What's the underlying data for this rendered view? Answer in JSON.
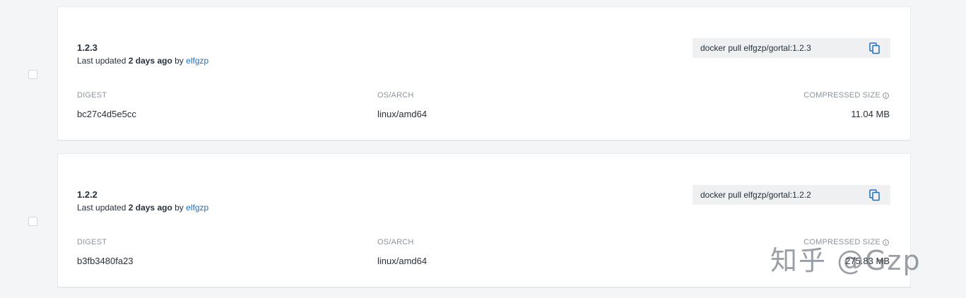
{
  "tags": [
    {
      "name": "1.2.3",
      "updated_prefix": "Last updated",
      "updated_when": "2 days ago",
      "updated_by_word": "by",
      "updated_by_user": "elfgzp",
      "pull_command": "docker pull elfgzp/gortal:1.2.3",
      "digest_label": "DIGEST",
      "digest": "bc27c4d5e5cc",
      "os_arch_label": "OS/ARCH",
      "os_arch": "linux/amd64",
      "size_label": "COMPRESSED SIZE",
      "size": "11.04 MB",
      "selected": false
    },
    {
      "name": "1.2.2",
      "updated_prefix": "Last updated",
      "updated_when": "2 days ago",
      "updated_by_word": "by",
      "updated_by_user": "elfgzp",
      "pull_command": "docker pull elfgzp/gortal:1.2.2",
      "digest_label": "DIGEST",
      "digest": "b3fb3480fa23",
      "os_arch_label": "OS/ARCH",
      "os_arch": "linux/amd64",
      "size_label": "COMPRESSED SIZE",
      "size": "275.83 MB",
      "selected": false
    }
  ],
  "watermark": "知乎 @Gzp",
  "icons": {
    "copy": "copy-icon",
    "info": "info-icon"
  },
  "colors": {
    "link": "#1d6fc2",
    "background": "#f4f5f7",
    "pull_box": "#eef0f2"
  }
}
